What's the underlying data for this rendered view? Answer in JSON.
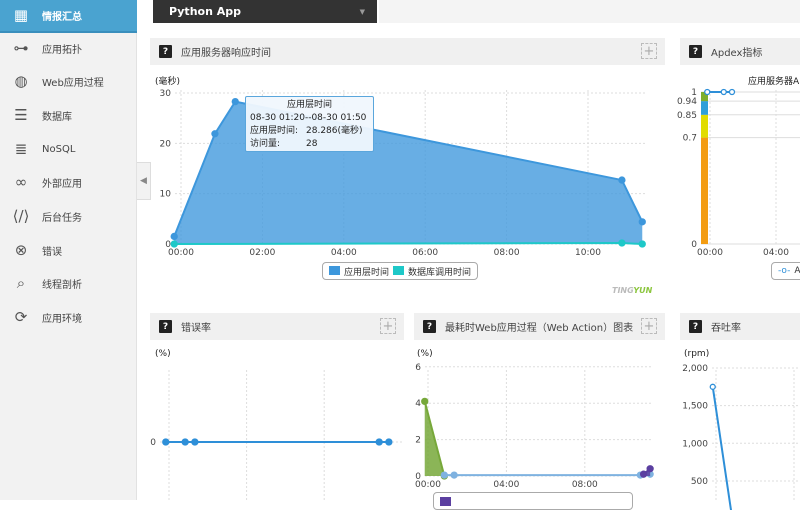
{
  "sidebar": {
    "items": [
      {
        "label": "情报汇总",
        "icon": "grid-icon",
        "glyph": "▦",
        "active": true
      },
      {
        "label": "应用拓扑",
        "icon": "topology-icon",
        "glyph": "⊶"
      },
      {
        "label": "Web应用过程",
        "icon": "globe-refresh-icon",
        "glyph": "◍"
      },
      {
        "label": "数据库",
        "icon": "database-icon",
        "glyph": "☰"
      },
      {
        "label": "NoSQL",
        "icon": "list-icon",
        "glyph": "≣"
      },
      {
        "label": "外部应用",
        "icon": "link-icon",
        "glyph": "∞"
      },
      {
        "label": "后台任务",
        "icon": "code-clipboard-icon",
        "glyph": "⟨/⟩"
      },
      {
        "label": "错误",
        "icon": "error-x-icon",
        "glyph": "⊗"
      },
      {
        "label": "线程剖析",
        "icon": "thread-search-icon",
        "glyph": "⌕"
      },
      {
        "label": "应用环境",
        "icon": "environment-tray-icon",
        "glyph": "⟳"
      }
    ],
    "collapse_glyph": "◀"
  },
  "app_selector": {
    "value": "Python App",
    "caret": "▼"
  },
  "panels": {
    "response": {
      "title": "应用服务器响应时间",
      "help": "?",
      "add": "+",
      "unit": "(毫秒)",
      "tooltip": {
        "title": "应用层时间",
        "range": "08-30 01:20--08-30 01:50",
        "k1": "应用层时间:",
        "v1": "28.286(毫秒)",
        "k2": "访问量:",
        "v2": "28"
      },
      "logo_a": "TING",
      "logo_b": "YUN"
    },
    "apdex": {
      "title": "Apdex指标",
      "help": "?",
      "chart_title": "应用服务器A",
      "legend": "A"
    },
    "error": {
      "title": "错误率",
      "help": "?",
      "add": "+",
      "unit": "(%)"
    },
    "webaction": {
      "title": "最耗时Web应用过程（Web Action）图表",
      "help": "?",
      "add": "+",
      "unit": "(%)"
    },
    "throughput": {
      "title": "吞吐率",
      "help": "?",
      "unit": "(rpm)"
    }
  },
  "chart_data": [
    {
      "id": "response",
      "type": "area",
      "ylabel": "(毫秒)",
      "ylim": [
        0,
        30
      ],
      "yticks": [
        "0",
        "10",
        "20",
        "30"
      ],
      "xticks": [
        "00:00",
        "02:00",
        "04:00",
        "06:00",
        "08:00",
        "10:00"
      ],
      "grid": true,
      "legend": "bottom",
      "series": [
        {
          "name": "应用层时间",
          "color": "#3d97dc",
          "x": [
            "23:50",
            "00:50",
            "01:20",
            "10:50",
            "11:20"
          ],
          "y": [
            1.5,
            21.9,
            28.286,
            12.7,
            4.4
          ]
        },
        {
          "name": "数据库调用时间",
          "color": "#1ec8c8",
          "x": [
            "23:50",
            "10:50",
            "11:20"
          ],
          "y": [
            0,
            0.2,
            0
          ]
        }
      ]
    },
    {
      "id": "apdex",
      "type": "line",
      "yticks": [
        "0",
        "0.7",
        "0.85",
        "0.94",
        "1"
      ],
      "xticks": [
        "00:00",
        "04:00"
      ],
      "bands": [
        {
          "from": 0,
          "to": 0.7,
          "color": "#f39c12"
        },
        {
          "from": 0.7,
          "to": 0.85,
          "color": "#e1dc00"
        },
        {
          "from": 0.85,
          "to": 0.94,
          "color": "#2e9fd8"
        },
        {
          "from": 0.94,
          "to": 1,
          "color": "#7cae2c"
        }
      ],
      "series": [
        {
          "color": "#2e8fd8",
          "x": [
            "23:50",
            "00:50",
            "01:20"
          ],
          "y": [
            1,
            1,
            1
          ]
        }
      ]
    },
    {
      "id": "error",
      "type": "line",
      "ylabel": "(%)",
      "yticks": [
        "0"
      ],
      "series": [
        {
          "color": "#2e8fd8",
          "x": [
            "23:50",
            "00:50",
            "01:20",
            "10:50",
            "11:20"
          ],
          "y": [
            0,
            0,
            0,
            0,
            0
          ]
        }
      ]
    },
    {
      "id": "webaction",
      "type": "area",
      "ylabel": "(%)",
      "ylim": [
        0,
        6
      ],
      "yticks": [
        "0",
        "2",
        "4",
        "6"
      ],
      "xticks": [
        "00:00",
        "04:00",
        "08:00"
      ],
      "series": [
        {
          "color": "#77a83a",
          "x": [
            "23:50",
            "00:50"
          ],
          "y": [
            4.1,
            0
          ]
        },
        {
          "color": "#7fb2e0",
          "x": [
            "00:50",
            "01:20",
            "10:50",
            "11:20"
          ],
          "y": [
            0.05,
            0.05,
            0.05,
            0.1
          ]
        },
        {
          "color": "#5b3fa0",
          "x": [
            "11:00",
            "11:20"
          ],
          "y": [
            0.1,
            0.4
          ]
        }
      ]
    },
    {
      "id": "throughput",
      "type": "line",
      "ylabel": "(rpm)",
      "yticks": [
        "500",
        "1,000",
        "1,500",
        "2,000"
      ],
      "series": [
        {
          "color": "#2e8fd8",
          "x": [
            "23:50",
            "00:50"
          ],
          "y": [
            1750,
            0
          ]
        }
      ]
    }
  ]
}
